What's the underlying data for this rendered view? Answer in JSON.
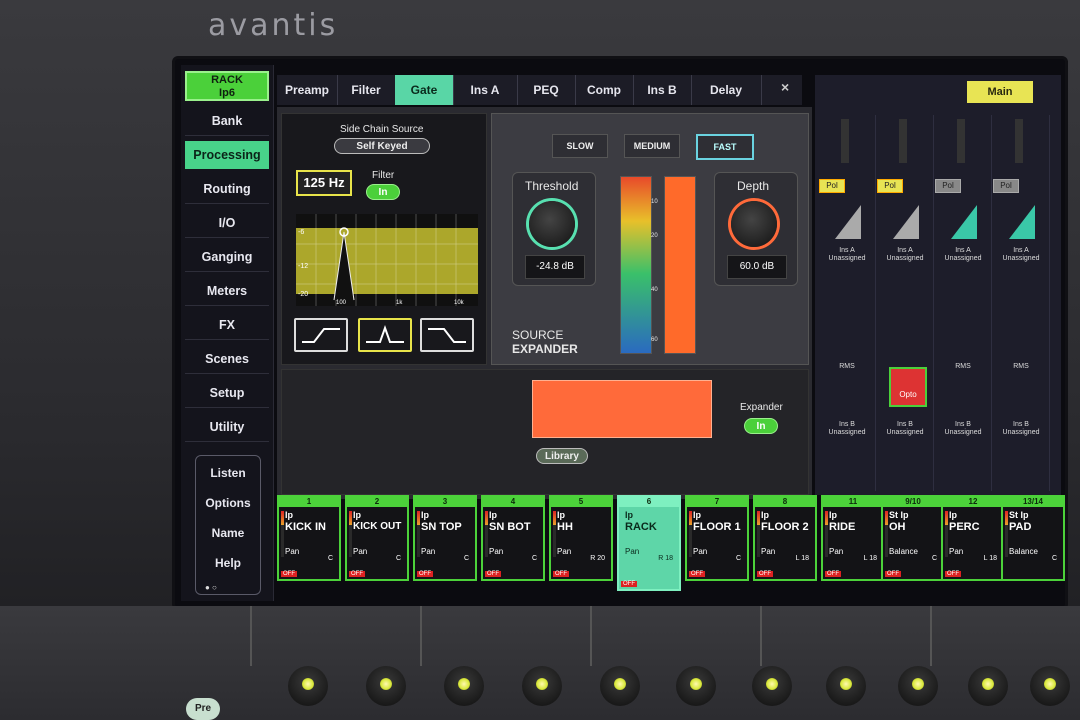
{
  "brand": "avantis",
  "nav": {
    "rack_btn": [
      "RACK",
      "Ip6"
    ],
    "items": [
      "Bank",
      "Processing",
      "Routing",
      "I/O",
      "Ganging",
      "Meters",
      "FX",
      "Scenes",
      "Setup",
      "Utility"
    ],
    "active": "Processing",
    "util": [
      "Listen",
      "Options",
      "Name",
      "Help"
    ]
  },
  "tabs": [
    "Preamp",
    "Filter",
    "Gate",
    "Ins A",
    "PEQ",
    "Comp",
    "Ins B",
    "Delay"
  ],
  "active_tab": "Gate",
  "close": "×",
  "filter": {
    "side_chain_label": "Side Chain Source",
    "side_chain_value": "Self Keyed",
    "freq": "125 Hz",
    "filter_label": "Filter",
    "filter_state": "In",
    "db_ticks": [
      "-6",
      "-12",
      "-20"
    ],
    "freq_ticks": [
      "100",
      "1k",
      "10k"
    ]
  },
  "gate": {
    "speeds": [
      "SLOW",
      "MEDIUM",
      "FAST"
    ],
    "active_speed": "FAST",
    "threshold_label": "Threshold",
    "threshold_value": "-24.8 dB",
    "depth_label": "Depth",
    "depth_value": "60.0 dB",
    "mode_line1": "SOURCE",
    "mode_line2": "EXPANDER",
    "meter_ticks": [
      "10",
      "20",
      "40",
      "60"
    ]
  },
  "expander": {
    "label": "Expander",
    "state": "In",
    "library": "Library"
  },
  "strips": {
    "main": "Main",
    "pol": "Pol",
    "ins_a": [
      "Ins A",
      "Unassigned"
    ],
    "ins_b": [
      "Ins B",
      "Unassigned"
    ],
    "rms": "RMS",
    "opto": "Opto",
    "main_small": "Main"
  },
  "channels": [
    {
      "num": "1",
      "src": "Ip",
      "name": "KICK IN",
      "pan": "Pan",
      "panval": "C"
    },
    {
      "num": "2",
      "src": "Ip",
      "name": "KICK OUT",
      "pan": "Pan",
      "panval": "C"
    },
    {
      "num": "3",
      "src": "Ip",
      "name": "SN TOP",
      "pan": "Pan",
      "panval": "C"
    },
    {
      "num": "4",
      "src": "Ip",
      "name": "SN BOT",
      "pan": "Pan",
      "panval": "C"
    },
    {
      "num": "5",
      "src": "Ip",
      "name": "HH",
      "pan": "Pan",
      "panval": "R 20"
    },
    {
      "num": "6",
      "src": "Ip",
      "name": "RACK",
      "pan": "Pan",
      "panval": "R 18"
    },
    {
      "num": "7",
      "src": "Ip",
      "name": "FLOOR 1",
      "pan": "Pan",
      "panval": "C"
    },
    {
      "num": "8",
      "src": "Ip",
      "name": "FLOOR 2",
      "pan": "Pan",
      "panval": "L 18"
    },
    {
      "num": "11",
      "src": "Ip",
      "name": "RIDE",
      "pan": "Pan",
      "panval": "L 18"
    },
    {
      "num": "9/10",
      "src": "St Ip",
      "name": "OH",
      "pan": "Balance",
      "panval": "C"
    },
    {
      "num": "12",
      "src": "Ip",
      "name": "PERC",
      "pan": "Pan",
      "panval": "L 18"
    },
    {
      "num": "13/14",
      "src": "St Ip",
      "name": "PAD",
      "pan": "Balance",
      "panval": "C"
    }
  ],
  "off_label": "OFF",
  "pre_button": "Pre"
}
